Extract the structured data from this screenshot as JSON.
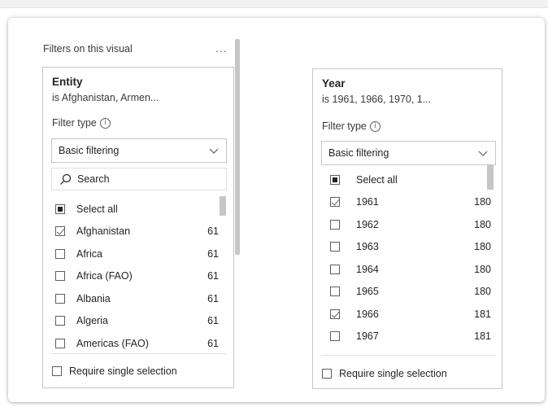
{
  "pane": {
    "title": "Filters on this visual",
    "more_label": "..."
  },
  "entity_card": {
    "title": "Entity",
    "subtitle": "is Afghanistan, Armen...",
    "filter_type_label": "Filter type",
    "info_glyph": "i",
    "dropdown_value": "Basic filtering",
    "search_placeholder": "Search",
    "items": [
      {
        "label": "Select all",
        "count": "",
        "state": "partial"
      },
      {
        "label": "Afghanistan",
        "count": "61",
        "state": "checked"
      },
      {
        "label": "Africa",
        "count": "61",
        "state": "unchecked"
      },
      {
        "label": "Africa (FAO)",
        "count": "61",
        "state": "unchecked"
      },
      {
        "label": "Albania",
        "count": "61",
        "state": "unchecked"
      },
      {
        "label": "Algeria",
        "count": "61",
        "state": "unchecked"
      },
      {
        "label": "Americas (FAO)",
        "count": "61",
        "state": "unchecked"
      }
    ],
    "require_single_label": "Require single selection"
  },
  "year_card": {
    "title": "Year",
    "subtitle": "is 1961, 1966, 1970, 1...",
    "filter_type_label": "Filter type",
    "info_glyph": "i",
    "dropdown_value": "Basic filtering",
    "items": [
      {
        "label": "Select all",
        "count": "",
        "state": "partial"
      },
      {
        "label": "1961",
        "count": "180",
        "state": "checked"
      },
      {
        "label": "1962",
        "count": "180",
        "state": "unchecked"
      },
      {
        "label": "1963",
        "count": "180",
        "state": "unchecked"
      },
      {
        "label": "1964",
        "count": "180",
        "state": "unchecked"
      },
      {
        "label": "1965",
        "count": "180",
        "state": "unchecked"
      },
      {
        "label": "1966",
        "count": "181",
        "state": "checked"
      },
      {
        "label": "1967",
        "count": "181",
        "state": "unchecked"
      }
    ],
    "require_single_label": "Require single selection"
  },
  "icons": [
    "chevron-down-icon",
    "search-icon",
    "info-icon",
    "checkbox-icon"
  ]
}
